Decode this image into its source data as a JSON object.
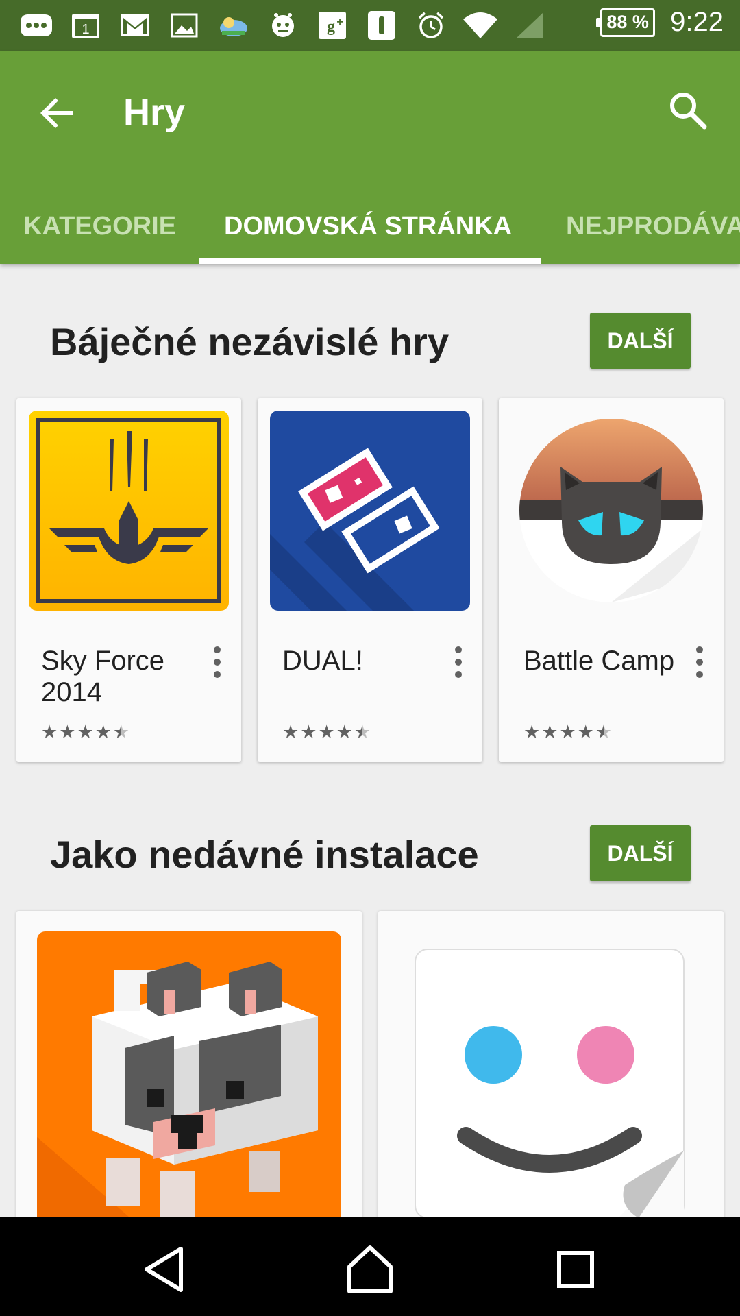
{
  "status_bar": {
    "battery": "88 %",
    "time": "9:22",
    "icons": [
      "messages-icon",
      "calendar-icon",
      "gmail-icon",
      "gallery-icon",
      "weather-icon",
      "robot-icon",
      "google-plus-icon",
      "app-icon",
      "alarm-icon",
      "wifi-icon",
      "signal-icon"
    ],
    "calendar_day": "1"
  },
  "app_bar": {
    "title": "Hry"
  },
  "tabs": [
    {
      "label": "KATEGORIE",
      "active": false
    },
    {
      "label": "DOMOVSKÁ STRÁNKA",
      "active": true
    },
    {
      "label": "NEJPRODÁVA",
      "active": false
    }
  ],
  "sections": [
    {
      "title": "Báječné nezávislé hry",
      "more_label": "DALŠÍ",
      "apps": [
        {
          "name": "Sky Force 2014",
          "rating": 4.5
        },
        {
          "name": "DUAL!",
          "rating": 4.5
        },
        {
          "name": "Battle Camp",
          "rating": 4.5
        }
      ]
    },
    {
      "title": "Jako nedávné instalace",
      "more_label": "DALŠÍ",
      "apps": []
    }
  ],
  "colors": {
    "status_bar": "#466b29",
    "app_bar": "#689f38",
    "button": "#558b2f"
  },
  "star_glyphs": "★★★★★"
}
